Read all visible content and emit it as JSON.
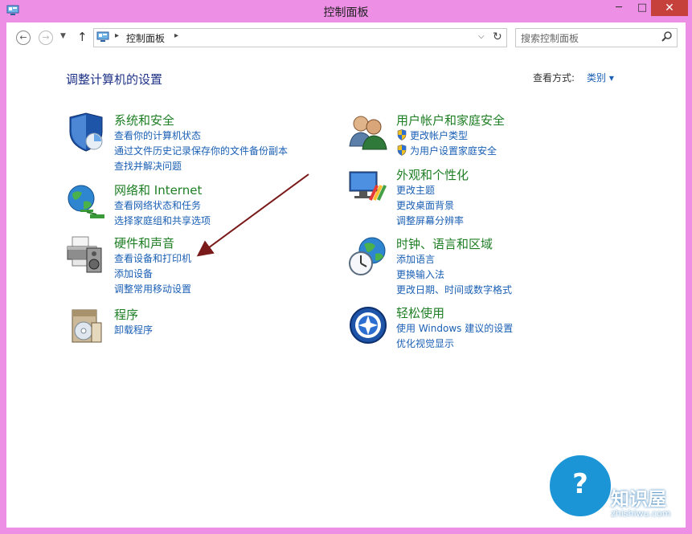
{
  "window": {
    "title": "控制面板",
    "minimize": "─",
    "maximize": "□",
    "close": "✕"
  },
  "nav": {
    "back": "←",
    "forward": "→",
    "history": "▼",
    "up": "↑",
    "breadcrumb": "控制面板",
    "separator": "▸",
    "address_dropdown": "⌵",
    "refresh": "↻"
  },
  "search": {
    "placeholder": "搜索控制面板"
  },
  "main": {
    "heading": "调整计算机的设置",
    "view_by_label": "查看方式:",
    "view_by_value": "类别 ▾"
  },
  "categories": {
    "system_security": {
      "title": "系统和安全",
      "links": [
        "查看你的计算机状态",
        "通过文件历史记录保存你的文件备份副本",
        "查找并解决问题"
      ]
    },
    "network": {
      "title": "网络和 Internet",
      "links": [
        "查看网络状态和任务",
        "选择家庭组和共享选项"
      ]
    },
    "hardware": {
      "title": "硬件和声音",
      "links": [
        "查看设备和打印机",
        "添加设备",
        "调整常用移动设置"
      ]
    },
    "programs": {
      "title": "程序",
      "links": [
        "卸载程序"
      ]
    },
    "user_accounts": {
      "title": "用户帐户和家庭安全",
      "links": [
        "更改帐户类型",
        "为用户设置家庭安全"
      ]
    },
    "appearance": {
      "title": "外观和个性化",
      "links": [
        "更改主题",
        "更改桌面背景",
        "调整屏幕分辨率"
      ]
    },
    "clock": {
      "title": "时钟、语言和区域",
      "links": [
        "添加语言",
        "更换输入法",
        "更改日期、时间或数字格式"
      ]
    },
    "ease": {
      "title": "轻松使用",
      "links": [
        "使用 Windows 建议的设置",
        "优化视觉显示"
      ]
    }
  },
  "watermark": {
    "mark": "?",
    "brand": "知识屋",
    "url": "zhishiwu.com"
  },
  "colors": {
    "window_frame": "#ee8fe6",
    "category_title": "#1e7e24",
    "link": "#1a5fb4",
    "heading": "#1e3287",
    "close_button": "#c7413c",
    "annotation_arrow": "#7a1a1a"
  }
}
